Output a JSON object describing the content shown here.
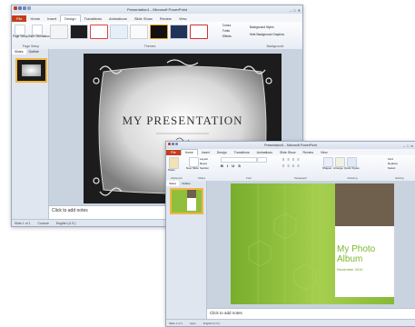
{
  "back_window": {
    "title": "Presentation1 - Microsoft PowerPoint",
    "tabs": [
      "File",
      "Home",
      "Insert",
      "Design",
      "Transitions",
      "Animations",
      "Slide Show",
      "Review",
      "View"
    ],
    "active_tab": "Design",
    "ribbon_groups": [
      "Page Setup",
      "Themes",
      "Background"
    ],
    "page_setup_buttons": [
      "Page Setup",
      "Slide Orientation"
    ],
    "theme_side_buttons": [
      "Colors",
      "Fonts",
      "Effects"
    ],
    "background_buttons": [
      "Background Styles",
      "Hide Background Graphics"
    ],
    "pane_tabs": [
      "Slides",
      "Outline"
    ],
    "slide": {
      "title": "MY PRESENTATION",
      "date": "November 2010"
    },
    "notes_placeholder": "Click to add notes",
    "status": [
      "Slide 1 of 1",
      "Couture",
      "English (U.S.)"
    ],
    "colors": {
      "slide_bg": "#1c1c1c",
      "file_tab": "#c43e1c"
    }
  },
  "front_window": {
    "title": "Presentation1 - Microsoft PowerPoint",
    "tabs": [
      "File",
      "Home",
      "Insert",
      "Design",
      "Transitions",
      "Animations",
      "Slide Show",
      "Review",
      "View"
    ],
    "active_tab": "Home",
    "ribbon_groups": [
      "Clipboard",
      "Slides",
      "Font",
      "Paragraph",
      "Drawing",
      "Editing"
    ],
    "home_buttons": [
      "Paste",
      "New Slide",
      "Layout",
      "Reset",
      "Section",
      "Shapes",
      "Arrange",
      "Quick Styles",
      "Find",
      "Replace",
      "Select"
    ],
    "pane_tabs": [
      "Slides",
      "Outline"
    ],
    "slide": {
      "title": "My Photo Album",
      "date": "November 2010"
    },
    "notes_placeholder": "Click to add notes",
    "status": [
      "Slide 1 of 1",
      "Apex",
      "English (U.S.)"
    ],
    "colors": {
      "slide_bg": "#8fbf3c",
      "title_text": "#7cb82f"
    }
  }
}
